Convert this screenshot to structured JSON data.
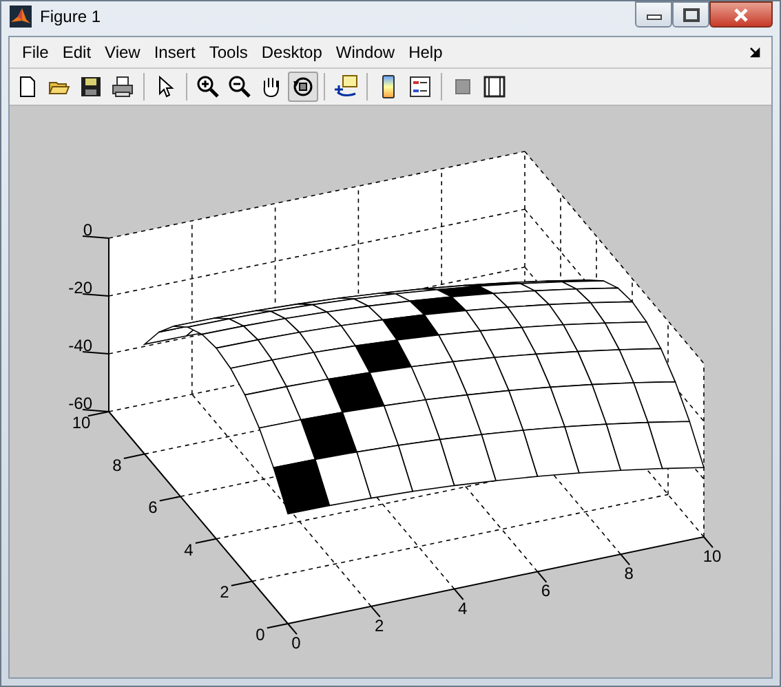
{
  "window": {
    "title": "Figure 1"
  },
  "menu": [
    {
      "label": "File"
    },
    {
      "label": "Edit"
    },
    {
      "label": "View"
    },
    {
      "label": "Insert"
    },
    {
      "label": "Tools"
    },
    {
      "label": "Desktop"
    },
    {
      "label": "Window"
    },
    {
      "label": "Help"
    }
  ],
  "toolbar": [
    {
      "kind": "new",
      "selected": false
    },
    {
      "kind": "open",
      "selected": false
    },
    {
      "kind": "save",
      "selected": false
    },
    {
      "kind": "print",
      "selected": false
    },
    {
      "kind": "sep"
    },
    {
      "kind": "pointer",
      "selected": false
    },
    {
      "kind": "sep"
    },
    {
      "kind": "zoom-in",
      "selected": false
    },
    {
      "kind": "zoom-out",
      "selected": false
    },
    {
      "kind": "pan",
      "selected": false
    },
    {
      "kind": "rotate",
      "selected": true
    },
    {
      "kind": "sep"
    },
    {
      "kind": "data-cursor",
      "selected": false
    },
    {
      "kind": "sep"
    },
    {
      "kind": "colorbar",
      "selected": false
    },
    {
      "kind": "legend",
      "selected": false
    },
    {
      "kind": "sep"
    },
    {
      "kind": "hide-tools",
      "selected": false
    },
    {
      "kind": "show-tools",
      "selected": false
    }
  ],
  "plot": {
    "z_ticks": [
      "0",
      "-20",
      "-40",
      "-60"
    ],
    "y_ticks": [
      "0",
      "2",
      "4",
      "6",
      "8",
      "10"
    ],
    "x_ticks": [
      "0",
      "2",
      "4",
      "6",
      "8",
      "10"
    ]
  }
}
